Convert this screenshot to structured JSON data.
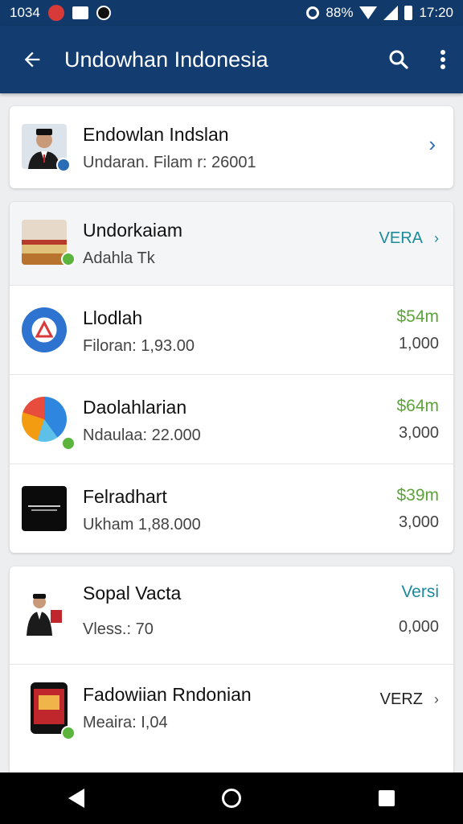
{
  "status_bar": {
    "time_left": "1034",
    "battery_percent": "88%",
    "time_right": "17:20"
  },
  "app_bar": {
    "back_icon": "arrow-left-icon",
    "title": "Undowhan Indonesia",
    "search_icon": "search-icon",
    "more_icon": "more-vert-icon"
  },
  "profile_card": {
    "name": "Endowlan Indslan",
    "subtitle": "Undaran. Filam r: 26001",
    "chevron": "›"
  },
  "list_card": {
    "items": [
      {
        "title": "Undorkaiam",
        "subtitle": "Adahla Tk",
        "right_top": "VERA",
        "right_arrow": "›",
        "right_bottom": ""
      },
      {
        "title": "Llodlah",
        "subtitle": "Filoran: 1,93.00",
        "right_top": "$54m",
        "right_bottom": "1,000"
      },
      {
        "title": "Daolahlarian",
        "subtitle": "Ndaulaa: 22.000",
        "right_top": "$64m",
        "right_bottom": "3,000"
      },
      {
        "title": "Felradhart",
        "subtitle": "Ukham 1,88.000",
        "right_top": "$39m",
        "right_bottom": "3,000"
      }
    ]
  },
  "bottom_card": {
    "items": [
      {
        "title": "Sopal Vacta",
        "subtitle": "Vless.: 70",
        "right_top": "Versi",
        "right_bottom": "0,000"
      },
      {
        "title": "Fadowiian Rndonian",
        "subtitle": "Meaira: I,04",
        "right_top": "VERZ",
        "right_arrow": "›"
      }
    ]
  },
  "colors": {
    "app_bar": "#133d70",
    "status_bar": "#113a6a",
    "money_green": "#5da33a",
    "teal": "#1b8a9a",
    "link_blue": "#2a6db5"
  }
}
